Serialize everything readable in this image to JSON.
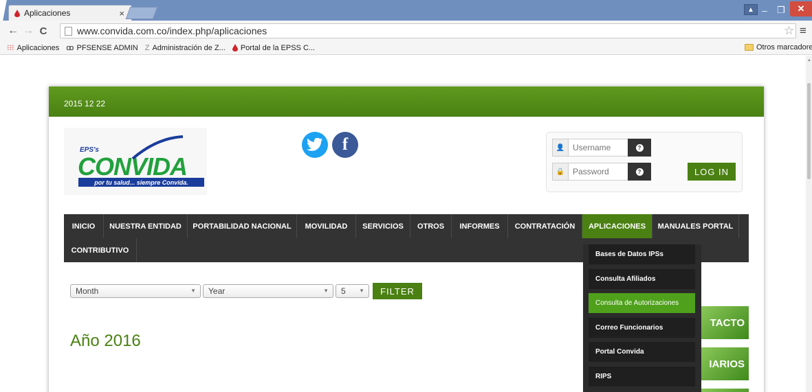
{
  "browser": {
    "tab_title": "Aplicaciones",
    "tab_close": "×",
    "url": "www.convida.com.co/index.php/aplicaciones",
    "bookmarks": [
      {
        "label": "Aplicaciones"
      },
      {
        "label": "PFSENSE ADMIN"
      },
      {
        "label": "Administración de Z..."
      },
      {
        "label": "Portal de la EPSS C..."
      }
    ],
    "other_bookmarks": "Otros marcadores"
  },
  "site": {
    "date": "2015 12 22",
    "logo": {
      "eps": "EPS's",
      "name": "CONVIDA",
      "tagline": "por tu salud... siempre Convida."
    },
    "login": {
      "username_placeholder": "Username",
      "password_placeholder": "Password",
      "button": "LOG IN"
    },
    "nav": [
      {
        "label": "INICIO"
      },
      {
        "label": "NUESTRA ENTIDAD"
      },
      {
        "label": "PORTABILIDAD NACIONAL"
      },
      {
        "label": "MOVILIDAD"
      },
      {
        "label": "SERVICIOS"
      },
      {
        "label": "OTROS"
      },
      {
        "label": "INFORMES"
      },
      {
        "label": "CONTRATACIÓN"
      },
      {
        "label": "APLICACIONES",
        "active": true
      },
      {
        "label": "MANUALES PORTAL"
      },
      {
        "label": "CONTRIBUTIVO"
      }
    ],
    "dropdown": [
      {
        "label": "Bases de Datos IPSs"
      },
      {
        "label": "Consulta Afiliados"
      },
      {
        "label": "Consulta de Autorizaciones",
        "active": true
      },
      {
        "label": "Correo Funcionarios"
      },
      {
        "label": "Portal Convida"
      },
      {
        "label": "RIPS"
      }
    ],
    "filters": {
      "month": "Month",
      "year": "Year",
      "limit": "5",
      "button": "FILTER"
    },
    "heading": "Año 2016",
    "banners": [
      "TACTO",
      "IARIOS"
    ]
  },
  "colors": {
    "brand_green": "#4a8112",
    "dropdown_active": "#4fa11b",
    "nav_bg": "#333333",
    "titlebar": "#6f8fbf"
  }
}
